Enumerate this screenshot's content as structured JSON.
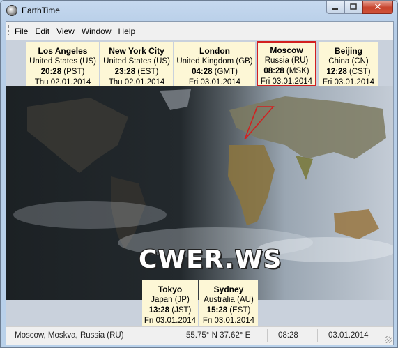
{
  "window": {
    "title": "EarthTime"
  },
  "menu": [
    "File",
    "Edit",
    "View",
    "Window",
    "Help"
  ],
  "top_clocks": [
    {
      "city": "Los Angeles",
      "country": "United States (US)",
      "time": "20:28",
      "zone": "(PST)",
      "date": "Thu 02.01.2014"
    },
    {
      "city": "New York City",
      "country": "United States (US)",
      "time": "23:28",
      "zone": "(EST)",
      "date": "Thu 02.01.2014"
    },
    {
      "city": "London",
      "country": "United Kingdom (GB)",
      "time": "04:28",
      "zone": "(GMT)",
      "date": "Fri 03.01.2014"
    },
    {
      "city": "Moscow",
      "country": "Russia (RU)",
      "time": "08:28",
      "zone": "(MSK)",
      "date": "Fri 03.01.2014"
    },
    {
      "city": "Beijing",
      "country": "China (CN)",
      "time": "12:28",
      "zone": "(CST)",
      "date": "Fri 03.01.2014"
    }
  ],
  "bottom_clocks": [
    {
      "city": "Tokyo",
      "country": "Japan (JP)",
      "time": "13:28",
      "zone": "(JST)",
      "date": "Fri 03.01.2014"
    },
    {
      "city": "Sydney",
      "country": "Australia (AU)",
      "time": "15:28",
      "zone": "(EST)",
      "date": "Fri 03.01.2014"
    }
  ],
  "watermark": "CWER.WS",
  "status": {
    "location": "Moscow, Moskva, Russia (RU)",
    "coords": "55.75° N  37.62° E",
    "time": "08:28",
    "date": "03.01.2014"
  }
}
